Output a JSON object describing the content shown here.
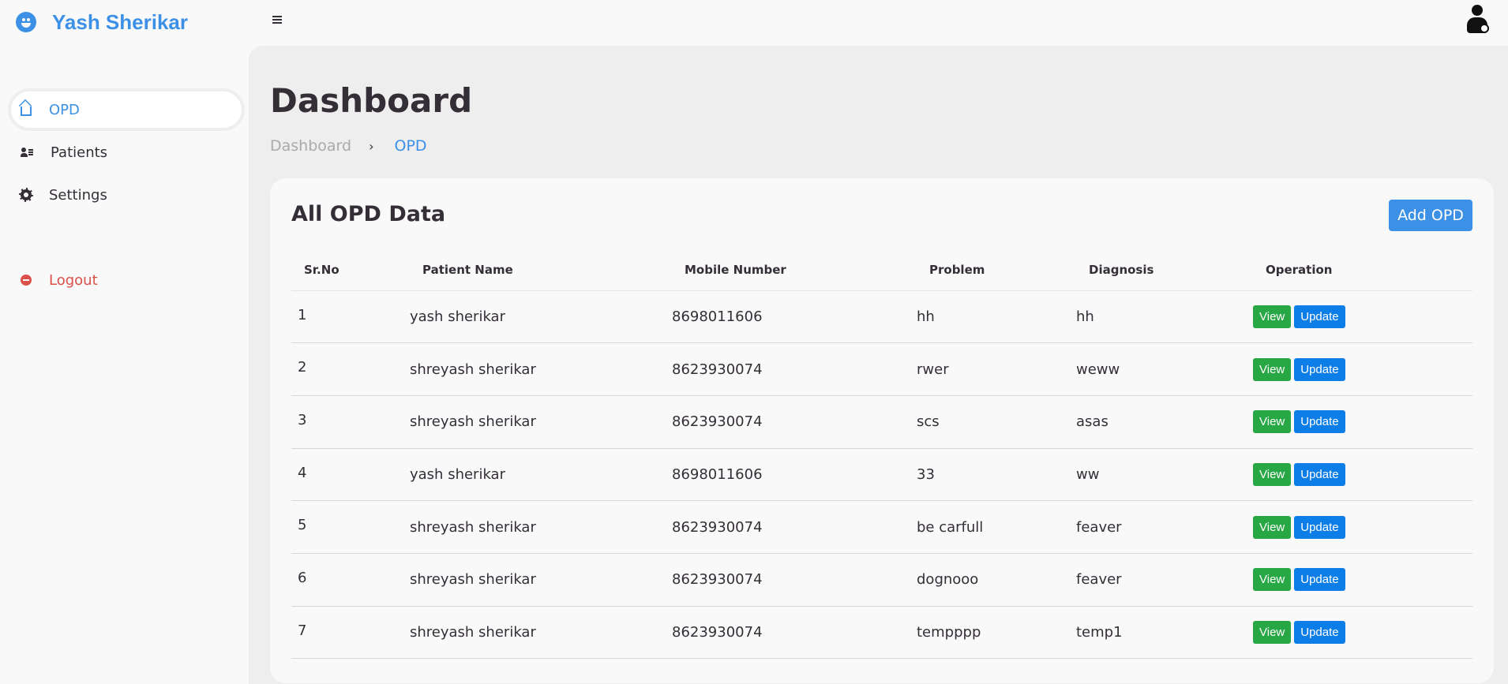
{
  "brand": {
    "name": "Yash Sherikar"
  },
  "sidebar": {
    "items": [
      {
        "label": "OPD",
        "icon": "house-icon",
        "active": true
      },
      {
        "label": "Patients",
        "icon": "users-icon",
        "active": false
      },
      {
        "label": "Settings",
        "icon": "gear-icon",
        "active": false
      }
    ],
    "logout": {
      "label": "Logout",
      "icon": "logout-icon"
    }
  },
  "header": {
    "title": "Dashboard"
  },
  "breadcrumb": {
    "root": "Dashboard",
    "separator": "›",
    "current": "OPD"
  },
  "card": {
    "title": "All OPD Data",
    "add_label": "Add OPD"
  },
  "table": {
    "columns": [
      "Sr.No",
      "Patient Name",
      "Mobile Number",
      "Problem",
      "Diagnosis",
      "Operation"
    ],
    "view_label": "View",
    "update_label": "Update",
    "rows": [
      {
        "sr": "1",
        "name": "yash sherikar",
        "mobile": "8698011606",
        "problem": "hh",
        "diagnosis": "hh"
      },
      {
        "sr": "2",
        "name": "shreyash sherikar",
        "mobile": "8623930074",
        "problem": "rwer",
        "diagnosis": "weww"
      },
      {
        "sr": "3",
        "name": "shreyash sherikar",
        "mobile": "8623930074",
        "problem": "scs",
        "diagnosis": "asas"
      },
      {
        "sr": "4",
        "name": "yash sherikar",
        "mobile": "8698011606",
        "problem": "33",
        "diagnosis": "ww"
      },
      {
        "sr": "5",
        "name": "shreyash sherikar",
        "mobile": "8623930074",
        "problem": "be carfull",
        "diagnosis": "feaver"
      },
      {
        "sr": "6",
        "name": "shreyash sherikar",
        "mobile": "8623930074",
        "problem": "dognooo",
        "diagnosis": "feaver"
      },
      {
        "sr": "7",
        "name": "shreyash sherikar",
        "mobile": "8623930074",
        "problem": "tempppp",
        "diagnosis": "temp1"
      }
    ]
  },
  "colors": {
    "accent": "#3c91e6",
    "danger": "#db504a",
    "view": "#28a745",
    "update": "#0d7ee8"
  }
}
